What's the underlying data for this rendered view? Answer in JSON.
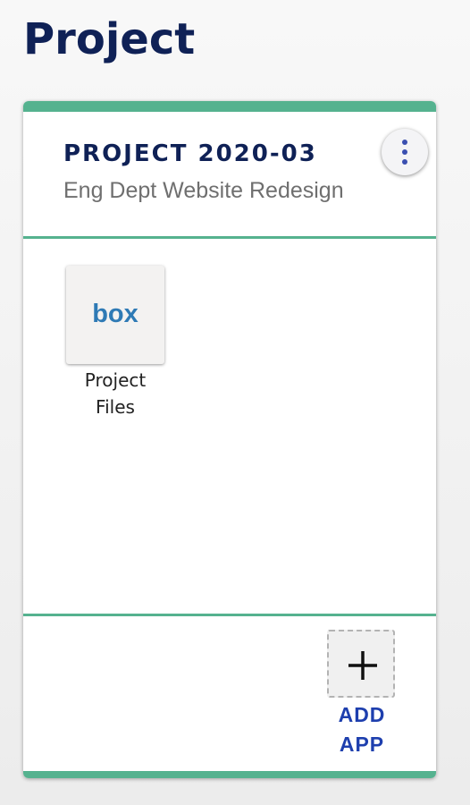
{
  "page": {
    "title": "Project"
  },
  "project_card": {
    "code": "PROJECT 2020-03",
    "name": "Eng Dept Website Redesign",
    "menu_icon": "more-vertical-icon",
    "accent_color": "#55b28f",
    "apps": [
      {
        "logo_text": "box",
        "logo_color": "#2e7ab5",
        "label_line1": "Project",
        "label_line2": "Files"
      }
    ],
    "add_app": {
      "icon": "plus-icon",
      "label_line1": "ADD",
      "label_line2": "APP"
    }
  },
  "colors": {
    "title": "#0f2156",
    "subtitle": "#6f6f6f",
    "link": "#1e3fae"
  }
}
